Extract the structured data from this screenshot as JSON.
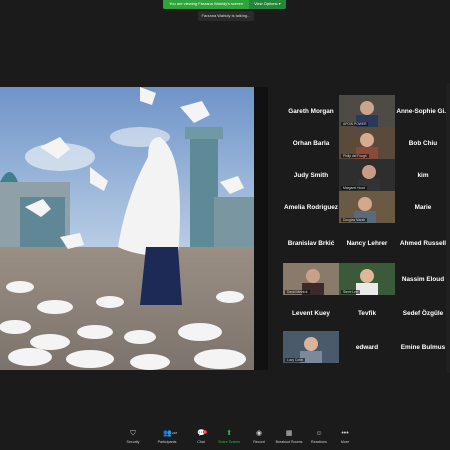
{
  "banner": {
    "message": "You are viewing Farzana Wahidy's screen",
    "options": "View Options ▾"
  },
  "talking_indicator": "Farzana Wahidy is talking...",
  "participants": [
    {
      "label": "Gareth Morgan",
      "video": false
    },
    {
      "label": "",
      "video": true,
      "nameplate": "APOW POWER"
    },
    {
      "label": "Anne-Sophie Gi...",
      "video": false
    },
    {
      "label": "Orhan Barla",
      "video": false
    },
    {
      "label": "",
      "video": true,
      "nameplate": "Philip del Fough"
    },
    {
      "label": "Bob Chiu",
      "video": false
    },
    {
      "label": "Judy Smith",
      "video": false
    },
    {
      "label": "",
      "video": true,
      "nameplate": "Margaret Hood"
    },
    {
      "label": "kim",
      "video": false
    },
    {
      "label": "Amelia Rodriguez",
      "video": false
    },
    {
      "label": "",
      "video": true,
      "nameplate": "Douglas Marsh"
    },
    {
      "label": "Marie",
      "video": false
    },
    {
      "label": "Branislav Brkić",
      "video": false
    },
    {
      "label": "Nancy Lehrer",
      "video": false
    },
    {
      "label": "Ahmed Russell",
      "video": false
    },
    {
      "label": "",
      "video": true,
      "nameplate": "David Melnick"
    },
    {
      "label": "",
      "video": true,
      "nameplate": "Steve Lee"
    },
    {
      "label": "Nassim Eloud",
      "video": false
    },
    {
      "label": "Levent Kuey",
      "video": false
    },
    {
      "label": "Tevfik",
      "video": false
    },
    {
      "label": "Sedef Özgüle",
      "video": false
    },
    {
      "label": "",
      "video": true,
      "nameplate": "Lucy Cobb"
    },
    {
      "label": "edward",
      "video": false
    },
    {
      "label": "Emine Bulmus",
      "video": false
    }
  ],
  "toolbar": {
    "security": "Security",
    "participants": "Participants",
    "participants_count": "248",
    "chat": "Chat",
    "chat_badge": "3",
    "share_screen": "Share Screen",
    "record": "Record",
    "breakout_rooms": "Breakout Rooms",
    "reactions": "Reactions",
    "more": "More"
  },
  "colors": {
    "background": "#1b1b1b",
    "share_green": "#2fa43c",
    "accent_green": "#2ebc4f"
  }
}
